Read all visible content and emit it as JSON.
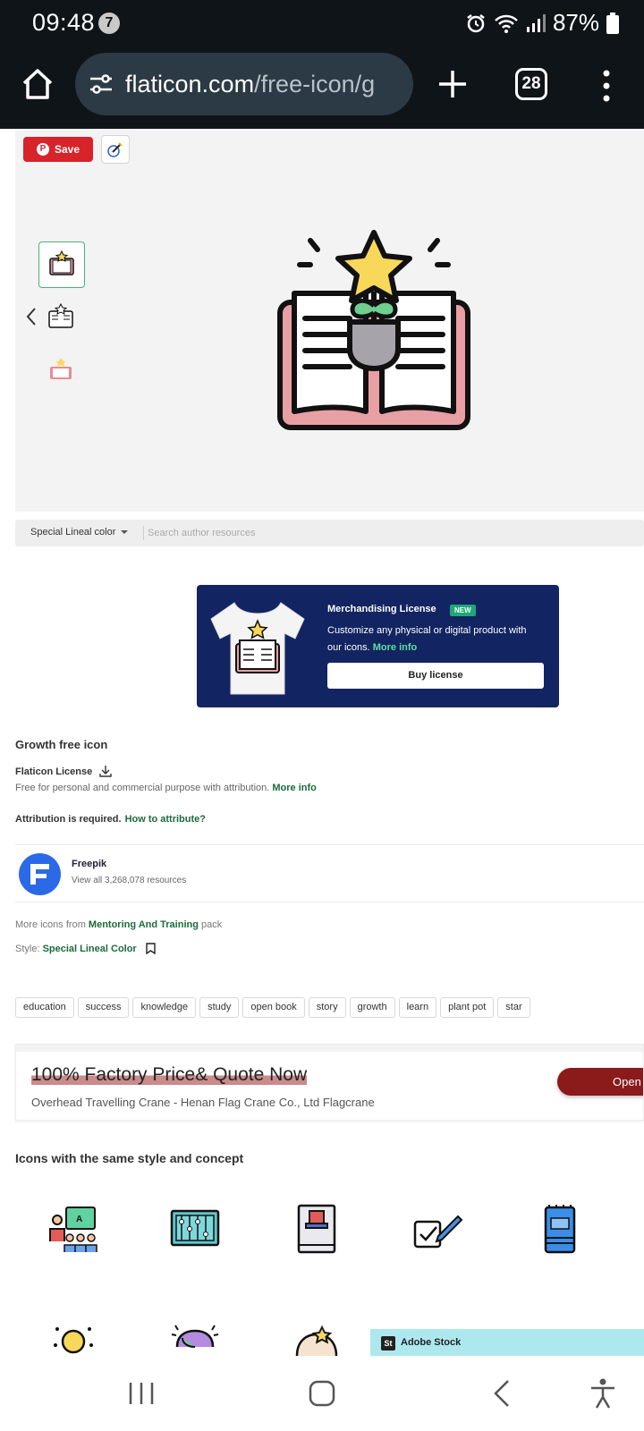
{
  "status_bar": {
    "time": "09:48",
    "notification_count": "7",
    "battery": "87%"
  },
  "browser": {
    "url_domain": "flaticon.com",
    "url_path": "/free-icon/g",
    "tab_count": "28"
  },
  "preview": {
    "save_label": "Save",
    "accent_color": "#d8232a"
  },
  "filter": {
    "style_selected": "Special Lineal color",
    "search_placeholder": "Search author resources"
  },
  "merch": {
    "title": "Merchandising License",
    "badge": "NEW",
    "description": "Customize any physical or digital product with our icons.",
    "more_info": "More info",
    "buy_label": "Buy license"
  },
  "details": {
    "title": "Growth free icon",
    "license_label": "Flaticon License",
    "license_desc": "Free for personal and commercial purpose with attribution.",
    "license_more": "More info",
    "attribution_text": "Attribution is required.",
    "attribution_link": "How to attribute?",
    "author_name": "Freepik",
    "author_resources": "View all 3,268,078 resources",
    "pack_prefix": "More icons from",
    "pack_name": "Mentoring And Training",
    "pack_suffix": "pack",
    "style_prefix": "Style:",
    "style_name": "Special Lineal Color",
    "link_color": "#1b6b3c"
  },
  "tags": [
    "education",
    "success",
    "knowledge",
    "study",
    "open book",
    "story",
    "growth",
    "learn",
    "plant pot",
    "star"
  ],
  "ad": {
    "headline": "100% Factory Price& Quote Now",
    "subline": "Overhead Travelling Crane - Henan Flag Crane Co., Ltd Flagcrane",
    "open_label": "Open"
  },
  "related": {
    "title": "Icons with the same style and concept",
    "icons": [
      "teacher-icon",
      "abacus-icon",
      "book-hat-icon",
      "checklist-pen-icon",
      "notebook-icon",
      "idea-bulb-icon",
      "brain-icon",
      "head-star-icon"
    ]
  },
  "adobe": {
    "logo": "St",
    "label": "Adobe Stock"
  }
}
